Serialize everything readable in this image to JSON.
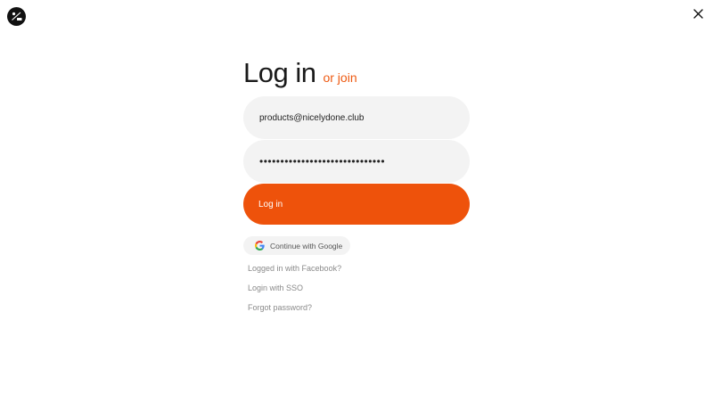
{
  "brand": {
    "logo_text": "5/m"
  },
  "heading": {
    "title": "Log in",
    "join_label": "or join"
  },
  "form": {
    "email_value": "products@nicelydone.club",
    "password_mask": "••••••••••••••••••••••••••••••",
    "submit_label": "Log in"
  },
  "social": {
    "google_label": "Continue with Google"
  },
  "links": {
    "facebook": "Logged in with Facebook?",
    "sso": "Login with SSO",
    "forgot": "Forgot password?"
  },
  "colors": {
    "accent": "#ee520b",
    "field_bg": "#f3f3f3",
    "muted_text": "#8a8a8a"
  },
  "icons": {
    "close": "close-icon",
    "google": "google-icon",
    "logo": "logo-icon"
  }
}
